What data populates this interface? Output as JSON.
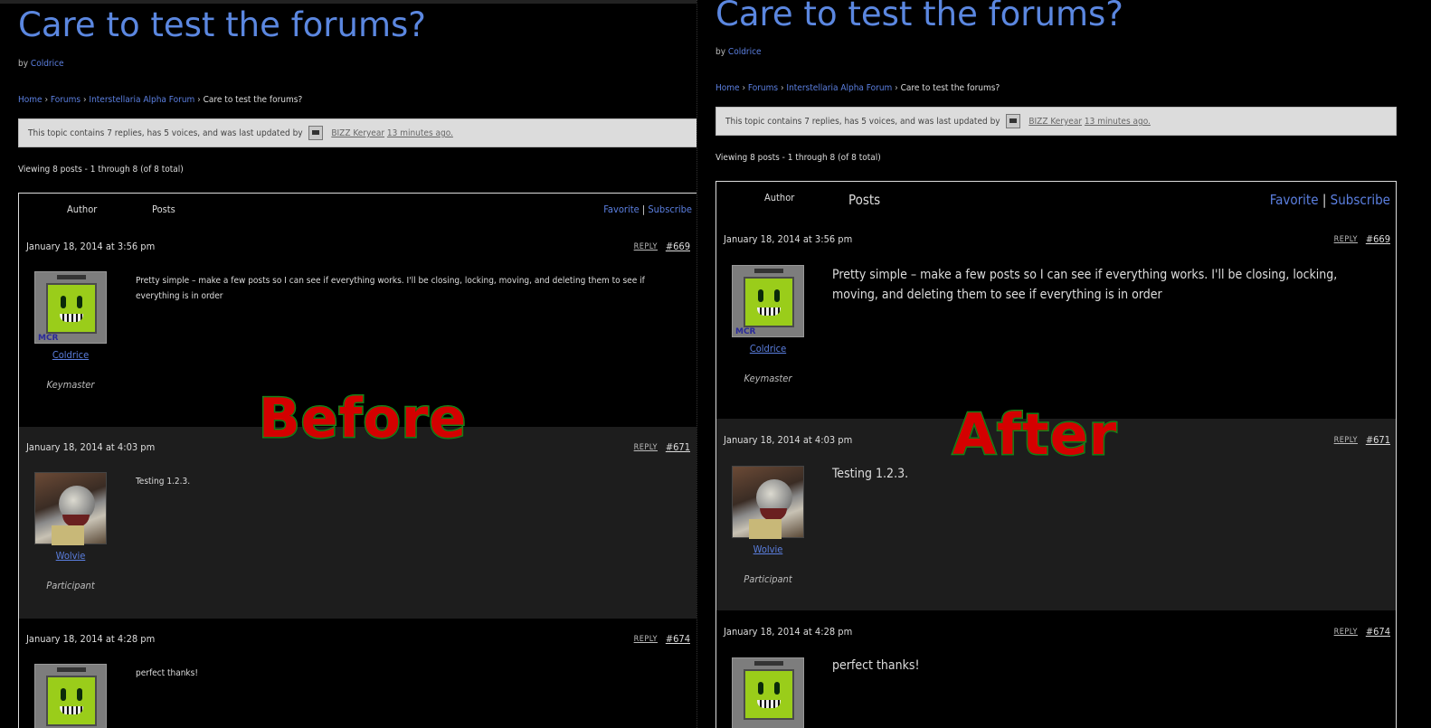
{
  "before": {
    "overlay_label": "Before",
    "title": "Care to test the forums?",
    "byline": {
      "prefix": "by",
      "author": "Coldrice"
    },
    "breadcrumbs": [
      "Home",
      "Forums",
      "Interstellaria Alpha Forum",
      "Care to test the forums?"
    ],
    "notice": {
      "text": "This topic contains 7 replies, has 5 voices, and was last updated by",
      "user": "BIZZ Keryear",
      "time": "13 minutes ago."
    },
    "viewing": "Viewing 8 posts - 1 through 8 (of 8 total)",
    "header": {
      "author": "Author",
      "posts": "Posts",
      "favorite": "Favorite",
      "separator": "|",
      "subscribe": "Subscribe"
    },
    "posts": [
      {
        "date": "January 18, 2014 at 3:56 pm",
        "reply": "REPLY",
        "number": "#669",
        "author": "Coldrice",
        "role": "Keymaster",
        "avatar_tag": "MCR",
        "content": "Pretty simple – make a few posts so I can see if everything works. I'll be closing, locking, moving, and deleting them to see if everything is in order"
      },
      {
        "date": "January 18, 2014 at 4:03 pm",
        "reply": "REPLY",
        "number": "#671",
        "author": "Wolvie",
        "role": "Participant",
        "content": "Testing 1.2.3."
      },
      {
        "date": "January 18, 2014 at 4:28 pm",
        "reply": "REPLY",
        "number": "#674",
        "content": "perfect thanks!"
      }
    ]
  },
  "after": {
    "overlay_label": "After",
    "title": "Care to test the forums?",
    "byline": {
      "prefix": "by",
      "author": "Coldrice"
    },
    "breadcrumbs": [
      "Home",
      "Forums",
      "Interstellaria Alpha Forum",
      "Care to test the forums?"
    ],
    "notice": {
      "text": "This topic contains 7 replies, has 5 voices, and was last updated by",
      "user": "BIZZ Keryear",
      "time": "13 minutes ago."
    },
    "viewing": "Viewing 8 posts - 1 through 8 (of 8 total)",
    "header": {
      "author": "Author",
      "posts": "Posts",
      "favorite": "Favorite",
      "separator": "|",
      "subscribe": "Subscribe"
    },
    "posts": [
      {
        "date": "January 18, 2014 at 3:56 pm",
        "reply": "REPLY",
        "number": "#669",
        "author": "Coldrice",
        "role": "Keymaster",
        "avatar_tag": "MCR",
        "content": "Pretty simple – make a few posts so I can see if everything works. I'll be closing, locking, moving, and deleting them to see if everything is in order"
      },
      {
        "date": "January 18, 2014 at 4:03 pm",
        "reply": "REPLY",
        "number": "#671",
        "author": "Wolvie",
        "role": "Participant",
        "content": "Testing 1.2.3."
      },
      {
        "date": "January 18, 2014 at 4:28 pm",
        "reply": "REPLY",
        "number": "#674",
        "content": "perfect thanks!"
      }
    ]
  },
  "colors": {
    "link": "#5b7fe0",
    "title": "#5b87e0",
    "overlay_fill": "#d40000",
    "overlay_stroke": "#1b8a1b"
  },
  "icons": {
    "avatar_robot": "robot-avatar-icon",
    "avatar_photo": "wolf-photo-avatar-icon",
    "notice_user": "user-mini-avatar-icon"
  }
}
